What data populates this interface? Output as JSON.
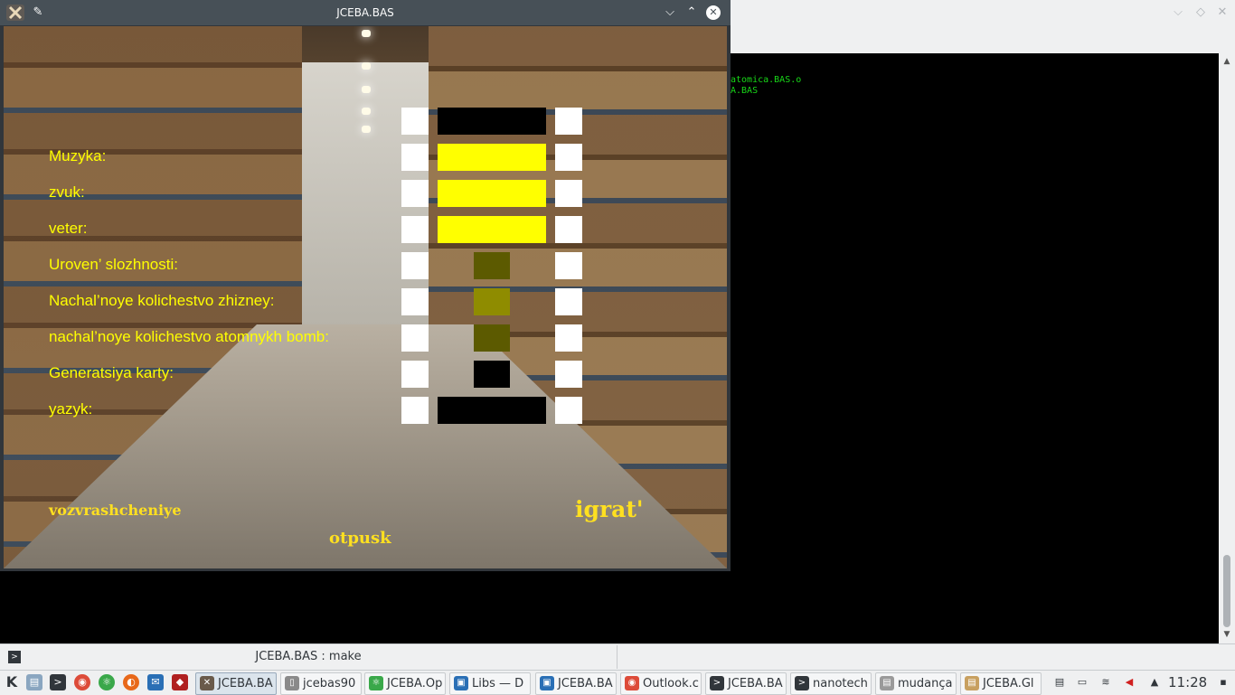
{
  "terminal": {
    "lines": [
      "atomica.BAS.o",
      "A.BAS"
    ]
  },
  "app": {
    "title": "JCEBA.BAS",
    "options": [
      {
        "label": "",
        "value_color": "#000000",
        "value_width": "wide"
      },
      {
        "label": "Muzyka:",
        "value_color": "#ffff00",
        "value_width": "wide"
      },
      {
        "label": "zvuk:",
        "value_color": "#ffff00",
        "value_width": "wide"
      },
      {
        "label": "veter:",
        "value_color": "#ffff00",
        "value_width": "wide"
      },
      {
        "label": "Uroven’ slozhnosti:",
        "value_color": "#5c5a00",
        "value_width": "narrow"
      },
      {
        "label": "Nachal’noye kolichestvo zhizney:",
        "value_color": "#8f8c00",
        "value_width": "narrow"
      },
      {
        "label": "nachal’noye kolichestvo atomnykh bomb:",
        "value_color": "#5c5a00",
        "value_width": "narrow"
      },
      {
        "label": "Generatsiya karty:",
        "value_color": "#000000",
        "value_width": "narrow"
      },
      {
        "label": "yazyk:",
        "value_color": "#000000",
        "value_width": "wide"
      }
    ],
    "buttons": {
      "back": "vozvrashcheniye",
      "play": "igrat'",
      "release": "otpusk"
    }
  },
  "konsole_tab": {
    "label": "JCEBA.BAS : make"
  },
  "taskbar": {
    "tasks": [
      {
        "label": "JCEBA.BA",
        "icon": "app-x-icon",
        "color": "#6a5a4a"
      },
      {
        "label": "jcebas90",
        "icon": "document-icon",
        "color": "#8a8a8a"
      },
      {
        "label": "JCEBA.Op",
        "icon": "atom-icon",
        "color": "#3aa84a"
      },
      {
        "label": "Libs — D",
        "icon": "folder-icon",
        "color": "#2a6fb5"
      },
      {
        "label": "JCEBA.BA",
        "icon": "folder-icon",
        "color": "#2a6fb5"
      },
      {
        "label": "Outlook.c",
        "icon": "chrome-icon",
        "color": "#dd4b39"
      },
      {
        "label": "JCEBA.BA",
        "icon": "terminal-icon",
        "color": "#31363b"
      },
      {
        "label": "nanotech",
        "icon": "terminal-icon",
        "color": "#31363b"
      },
      {
        "label": "mudança",
        "icon": "text-file-icon",
        "color": "#9a9a9a"
      },
      {
        "label": "JCEBA.Gl",
        "icon": "text-file-icon",
        "color": "#c8a060"
      }
    ],
    "clock": "11:28"
  }
}
